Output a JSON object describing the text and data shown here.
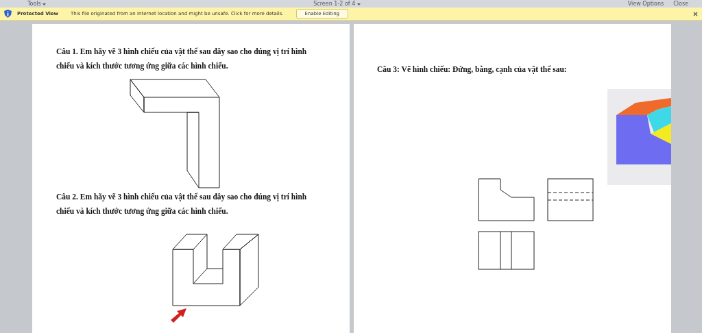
{
  "toolbar": {
    "left": [
      {
        "label": "Tools"
      }
    ],
    "center": {
      "label": "Screen 1-2 of 4"
    },
    "right": [
      {
        "label": "View Options"
      },
      {
        "label": "Close"
      }
    ]
  },
  "protected_view": {
    "title": "Protected View",
    "message": "This file originated from an Internet location and might be unsafe. Click for more details.",
    "button": "Enable Editing"
  },
  "pages": [
    {
      "questions": [
        {
          "kind": "bracket",
          "text": "Câu 1. Em hãy vẽ 3 hình chiếu của vật thể sau đây sao cho đúng vị trí hình chiếu và kích thước tương ứng giữa các hình chiếu."
        },
        {
          "kind": "channel",
          "text": "Câu 2. Em hãy vẽ 3 hình chiếu của vật thể sau đây sao cho đúng vị trí hình chiếu và kích thước tương ứng giữa các hình chiếu."
        }
      ]
    },
    {
      "questions": [
        {
          "kind": "views",
          "text": "Câu 3: Vẽ hình chiếu: Đứng, bằng, cạnh của vật thể sau:"
        }
      ]
    }
  ]
}
